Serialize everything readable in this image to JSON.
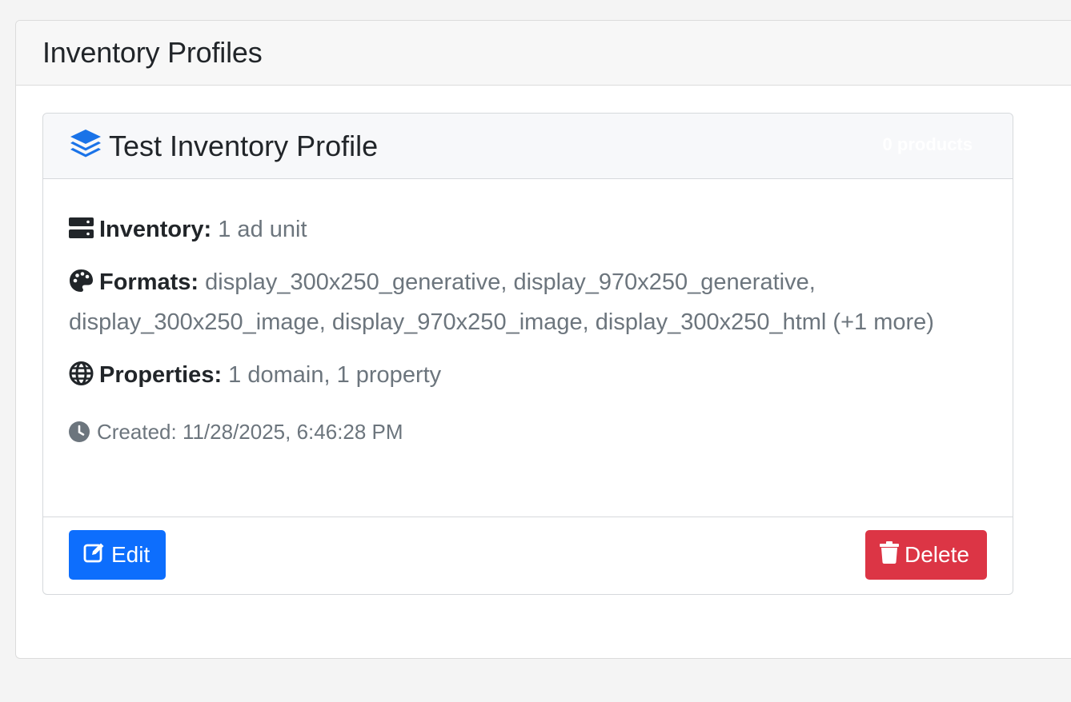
{
  "page": {
    "title": "Inventory Profiles"
  },
  "profile": {
    "name": "Test Inventory Profile",
    "products_badge": "0 products",
    "inventory": {
      "label": "Inventory:",
      "value": "1 ad unit",
      "icon": "server-icon"
    },
    "formats": {
      "label": "Formats:",
      "value": "display_300x250_generative, display_970x250_generative, display_300x250_image, display_970x250_image, display_300x250_html (+1 more)",
      "icon": "palette-icon"
    },
    "properties": {
      "label": "Properties:",
      "value": "1 domain, 1 property",
      "icon": "globe-icon"
    },
    "created": "Created: 11/28/2025, 6:46:28 PM",
    "edit_label": "Edit",
    "delete_label": "Delete"
  },
  "colors": {
    "primary": "#0d6efd",
    "danger": "#dc3545",
    "muted": "#6c757d",
    "title_icon": "#1a73e8"
  }
}
